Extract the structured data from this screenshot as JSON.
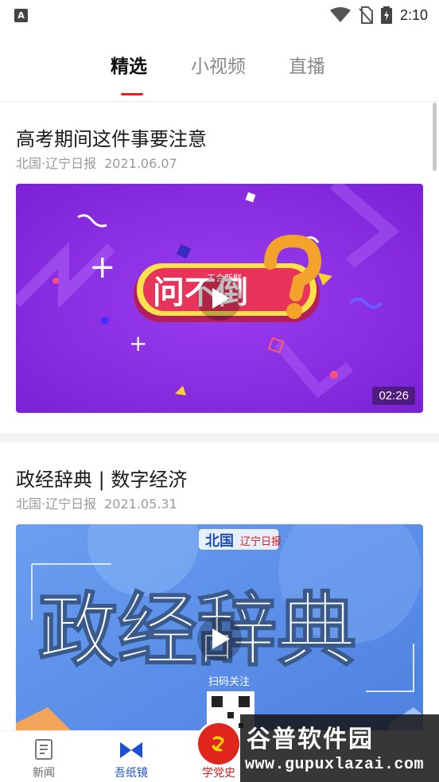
{
  "status_bar": {
    "notification_icon": "A",
    "time": "2:10"
  },
  "tabs": [
    {
      "label": "精选",
      "active": true
    },
    {
      "label": "小视频",
      "active": false
    },
    {
      "label": "直播",
      "active": false
    }
  ],
  "feed": [
    {
      "title": "高考期间这件事要注意",
      "source": "北国·辽宁日报",
      "date": "2021.06.07",
      "video": {
        "overlay_text": "问不倒",
        "small_text": "工会新鲜",
        "duration": "02:26"
      }
    },
    {
      "title": "政经辞典 | 数字经济",
      "source": "北国·辽宁日报",
      "date": "2021.05.31",
      "video": {
        "overlay_text": "政经辞典",
        "brand_text": "北国",
        "scan_text": "扫码关注"
      }
    }
  ],
  "bottom_nav": [
    {
      "label": "新闻",
      "icon": "news-icon"
    },
    {
      "label": "吾纸镜",
      "icon": "paper-mirror-icon"
    },
    {
      "label": "学党史",
      "icon": "party-emblem-icon"
    }
  ],
  "watermark": {
    "logo": "谷普软件园",
    "url": "www.gupuxlazai.com"
  },
  "colors": {
    "accent": "#e2231a",
    "nav_active_blue": "#1a4fd6",
    "video1_bg": "#8a2be2",
    "video2_bg": "#5b8fe3"
  }
}
